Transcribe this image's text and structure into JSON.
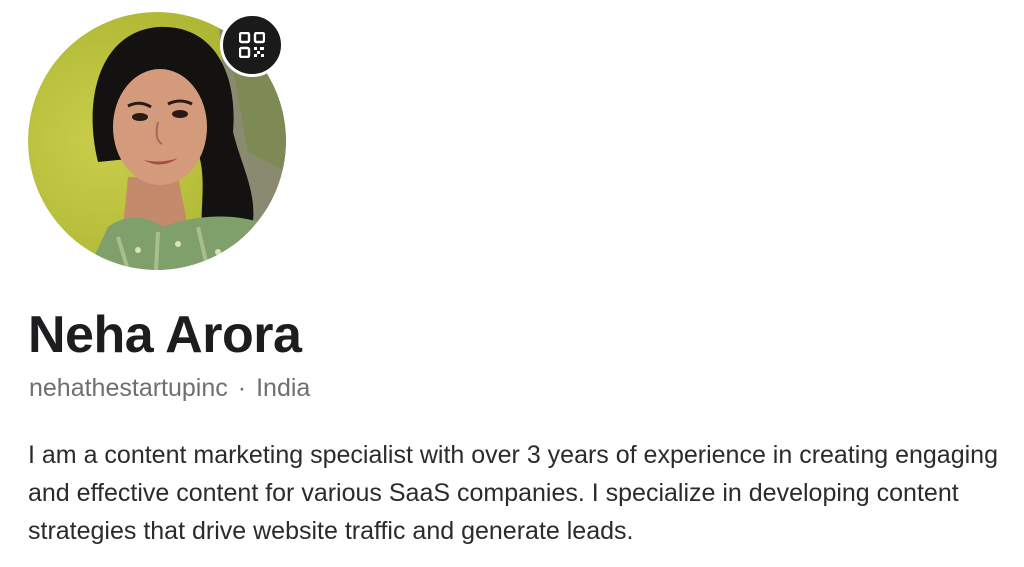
{
  "profile": {
    "name": "Neha Arora",
    "username": "nehathestartupinc",
    "separator": "·",
    "location": "India",
    "bio": "I am a content marketing specialist with over 3 years of experience in creating engaging and effective content for various SaaS companies. I specialize in developing content strategies that drive website traffic and generate leads."
  },
  "icons": {
    "qr": "qr-code-icon"
  },
  "colors": {
    "name_text": "#1d1d1f",
    "meta_text": "#6e6e73",
    "qr_button_bg": "#1a1a1a",
    "avatar_bg": "#b8c23a"
  }
}
